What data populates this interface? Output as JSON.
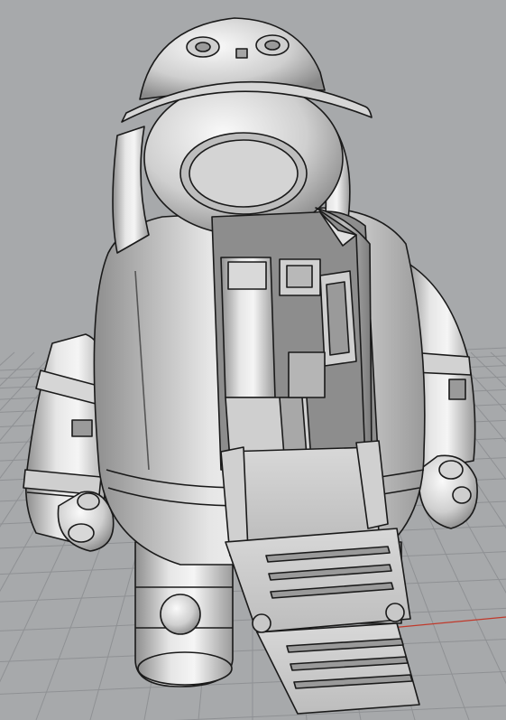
{
  "viewport": {
    "background": "#a7a9ab",
    "grid_color": "#8f9194",
    "axis_x_color": "#c0392b",
    "axis_y_color": "#2ecc40",
    "model_base_color": "#c9c9c9",
    "model_highlight_color": "#f2f2f2",
    "model_shadow_color": "#7d7d7d",
    "outline_color": "#1a1a1a"
  },
  "model": {
    "subject": "astronaut-robot-figure",
    "parts": [
      "helmet-cap",
      "face-visor",
      "hood",
      "torso",
      "chest-hatch-open",
      "cockpit-seat",
      "control-panel",
      "boarding-ramp",
      "left-arm",
      "right-arm",
      "left-hand",
      "right-hand",
      "left-leg",
      "right-leg",
      "knee-joint"
    ]
  }
}
